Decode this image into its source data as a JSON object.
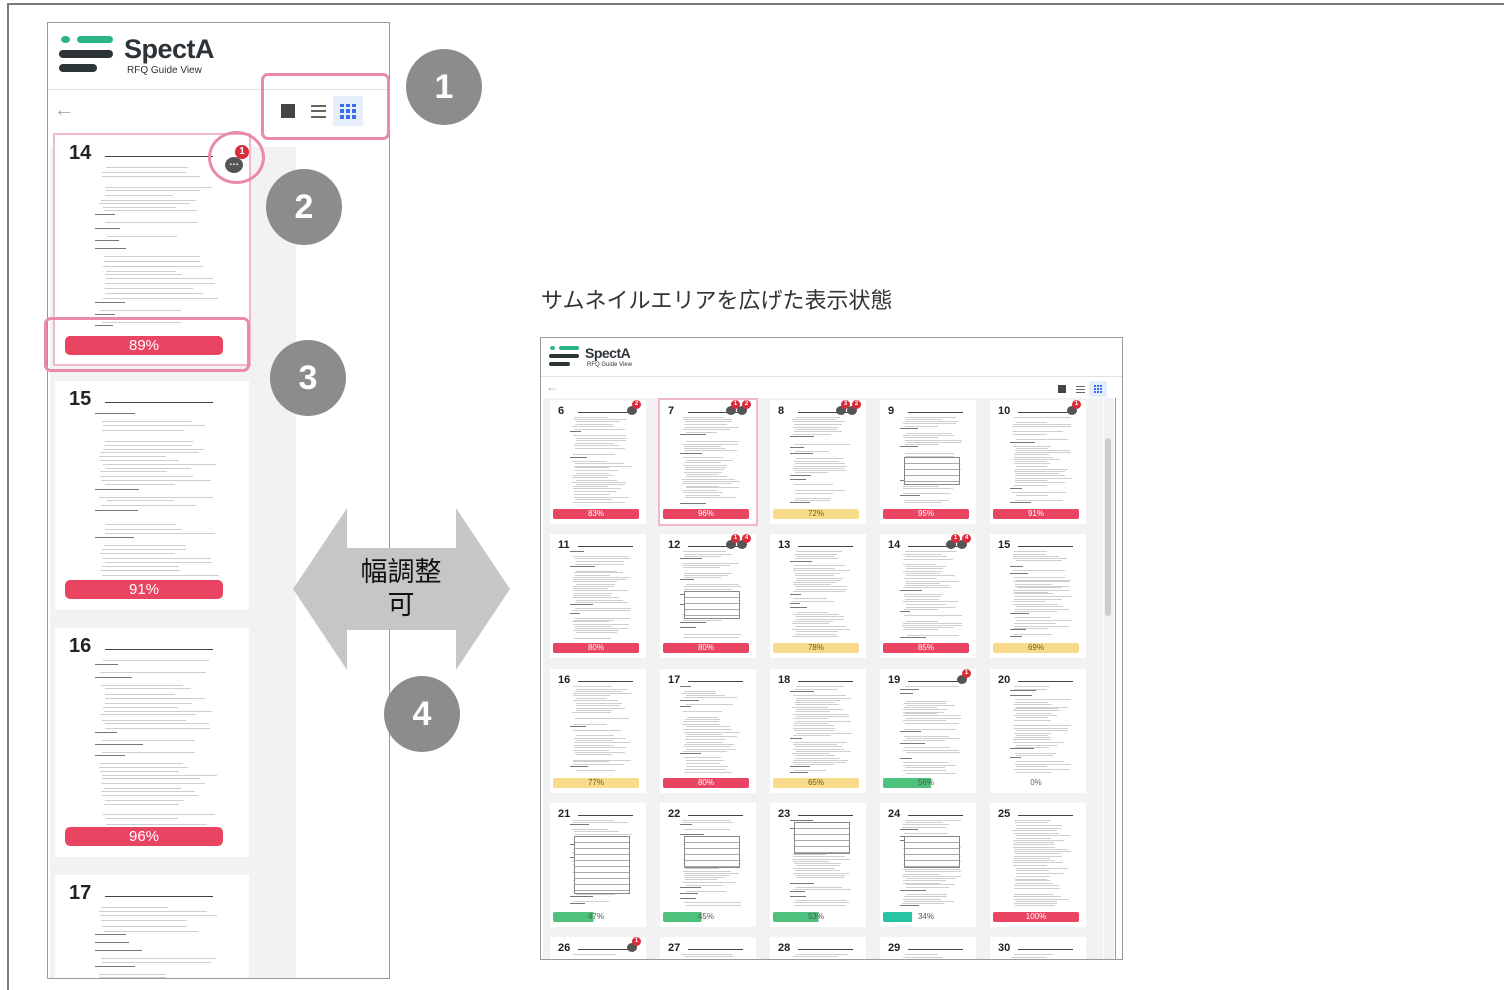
{
  "app": {
    "logo_title": "SpectA",
    "logo_subtitle": "RFQ Guide View",
    "back_icon": "arrow-left-icon",
    "view_modes": [
      {
        "label": "single",
        "icon": "square-icon",
        "active": false
      },
      {
        "label": "list",
        "icon": "list-icon",
        "active": false
      },
      {
        "label": "grid",
        "icon": "grid-icon",
        "active": true
      }
    ]
  },
  "left_panel": {
    "cards": [
      {
        "page": "14",
        "progress": "89%",
        "value": 89,
        "status": "red",
        "comments": 1,
        "selected": true
      },
      {
        "page": "15",
        "progress": "91%",
        "value": 91,
        "status": "red",
        "comments": 0,
        "selected": false
      },
      {
        "page": "16",
        "progress": "96%",
        "value": 96,
        "status": "red",
        "comments": 0,
        "selected": false
      },
      {
        "page": "17",
        "progress": "",
        "value": 0,
        "status": "none",
        "comments": 0,
        "selected": false
      }
    ]
  },
  "callouts": [
    "1",
    "2",
    "3",
    "4"
  ],
  "resize": {
    "label_line1": "幅調整",
    "label_line2": "可"
  },
  "caption": "サムネイルエリアを広げた表示状態",
  "right_panel": {
    "rows": [
      [
        {
          "page": "6",
          "progress": "83%",
          "value": 83,
          "status": "red",
          "badges": [
            "2"
          ]
        },
        {
          "page": "7",
          "progress": "96%",
          "value": 96,
          "status": "red",
          "badges": [
            "1",
            "2"
          ],
          "selected": true
        },
        {
          "page": "8",
          "progress": "72%",
          "value": 72,
          "status": "yellow",
          "badges": [
            "3",
            "2"
          ]
        },
        {
          "page": "9",
          "progress": "95%",
          "value": 95,
          "status": "red",
          "badges": []
        },
        {
          "page": "10",
          "progress": "91%",
          "value": 91,
          "status": "red",
          "badges": [
            "1"
          ]
        }
      ],
      [
        {
          "page": "11",
          "progress": "80%",
          "value": 80,
          "status": "red",
          "badges": []
        },
        {
          "page": "12",
          "progress": "80%",
          "value": 80,
          "status": "red",
          "badges": [
            "1",
            "4"
          ]
        },
        {
          "page": "13",
          "progress": "78%",
          "value": 78,
          "status": "yellow",
          "badges": []
        },
        {
          "page": "14",
          "progress": "85%",
          "value": 85,
          "status": "red",
          "badges": [
            "1",
            "4"
          ]
        },
        {
          "page": "15",
          "progress": "69%",
          "value": 69,
          "status": "yellow",
          "badges": []
        }
      ],
      [
        {
          "page": "16",
          "progress": "77%",
          "value": 77,
          "status": "yellow",
          "badges": []
        },
        {
          "page": "17",
          "progress": "80%",
          "value": 80,
          "status": "red",
          "badges": []
        },
        {
          "page": "18",
          "progress": "65%",
          "value": 65,
          "status": "yellow",
          "badges": []
        },
        {
          "page": "19",
          "progress": "56%",
          "value": 56,
          "status": "green",
          "badges": [
            "1"
          ]
        },
        {
          "page": "20",
          "progress": "0%",
          "value": 0,
          "status": "empty",
          "badges": []
        }
      ],
      [
        {
          "page": "21",
          "progress": "47%",
          "value": 47,
          "status": "green",
          "badges": []
        },
        {
          "page": "22",
          "progress": "45%",
          "value": 45,
          "status": "green",
          "badges": []
        },
        {
          "page": "23",
          "progress": "53%",
          "value": 53,
          "status": "green",
          "badges": []
        },
        {
          "page": "24",
          "progress": "34%",
          "value": 34,
          "status": "teal",
          "badges": []
        },
        {
          "page": "25",
          "progress": "100%",
          "value": 100,
          "status": "red",
          "badges": []
        }
      ],
      [
        {
          "page": "26",
          "progress": "",
          "value": 0,
          "status": "none",
          "badges": [
            "1"
          ]
        },
        {
          "page": "27",
          "progress": "",
          "value": 0,
          "status": "none",
          "badges": []
        },
        {
          "page": "28",
          "progress": "",
          "value": 0,
          "status": "none",
          "badges": []
        },
        {
          "page": "29",
          "progress": "",
          "value": 0,
          "status": "none",
          "badges": []
        },
        {
          "page": "30",
          "progress": "",
          "value": 0,
          "status": "none",
          "badges": []
        }
      ]
    ]
  },
  "colors": {
    "red": "#ea4463",
    "yellow": "#f8dc8c",
    "green": "#4ec27c",
    "teal": "#27c4a6",
    "callout": "#8c8c8c",
    "highlight": "#e88aa8"
  }
}
